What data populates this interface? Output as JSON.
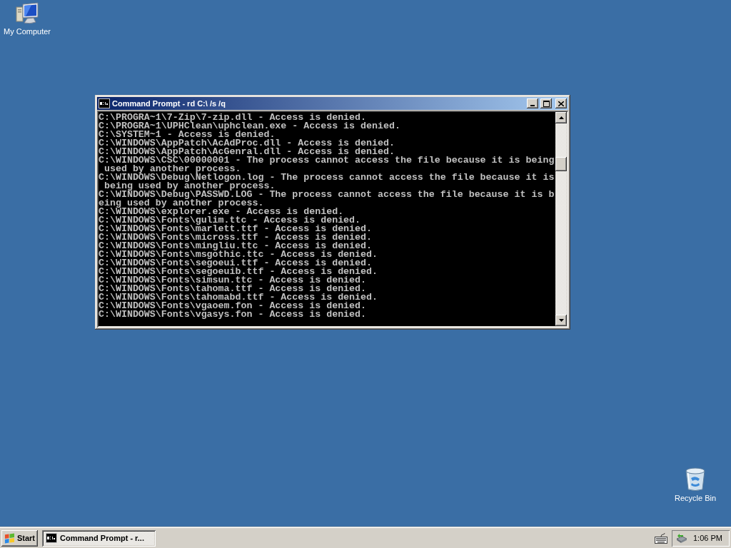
{
  "desktop_icons": [
    {
      "kind": "computer",
      "label": "My Computer"
    },
    {
      "kind": "recycle-bin",
      "label": "Recycle Bin"
    }
  ],
  "window": {
    "title": "Command Prompt - rd C:\\ /s /q",
    "console_lines": [
      "C:\\PROGRA~1\\7-Zip\\7-zip.dll - Access is denied.",
      "C:\\PROGRA~1\\UPHClean\\uphclean.exe - Access is denied.",
      "C:\\SYSTEM~1 - Access is denied.",
      "C:\\WINDOWS\\AppPatch\\AcAdProc.dll - Access is denied.",
      "C:\\WINDOWS\\AppPatch\\AcGenral.dll - Access is denied.",
      "C:\\WINDOWS\\CSC\\00000001 - The process cannot access the file because it is being",
      " used by another process.",
      "C:\\WINDOWS\\Debug\\Netlogon.log - The process cannot access the file because it is",
      " being used by another process.",
      "C:\\WINDOWS\\Debug\\PASSWD.LOG - The process cannot access the file because it is b",
      "eing used by another process.",
      "C:\\WINDOWS\\explorer.exe - Access is denied.",
      "C:\\WINDOWS\\Fonts\\gulim.ttc - Access is denied.",
      "C:\\WINDOWS\\Fonts\\marlett.ttf - Access is denied.",
      "C:\\WINDOWS\\Fonts\\micross.ttf - Access is denied.",
      "C:\\WINDOWS\\Fonts\\mingliu.ttc - Access is denied.",
      "C:\\WINDOWS\\Fonts\\msgothic.ttc - Access is denied.",
      "C:\\WINDOWS\\Fonts\\segoeui.ttf - Access is denied.",
      "C:\\WINDOWS\\Fonts\\segoeuib.ttf - Access is denied.",
      "C:\\WINDOWS\\Fonts\\simsun.ttc - Access is denied.",
      "C:\\WINDOWS\\Fonts\\tahoma.ttf - Access is denied.",
      "C:\\WINDOWS\\Fonts\\tahomabd.ttf - Access is denied.",
      "C:\\WINDOWS\\Fonts\\vgaoem.fon - Access is denied.",
      "C:\\WINDOWS\\Fonts\\vgasys.fon - Access is denied."
    ]
  },
  "taskbar": {
    "start_button": {
      "label": "Start"
    },
    "tasks": [
      {
        "label": "Command Prompt - r...",
        "selected": true
      }
    ],
    "tray": {
      "clock": "1:06 PM"
    }
  }
}
